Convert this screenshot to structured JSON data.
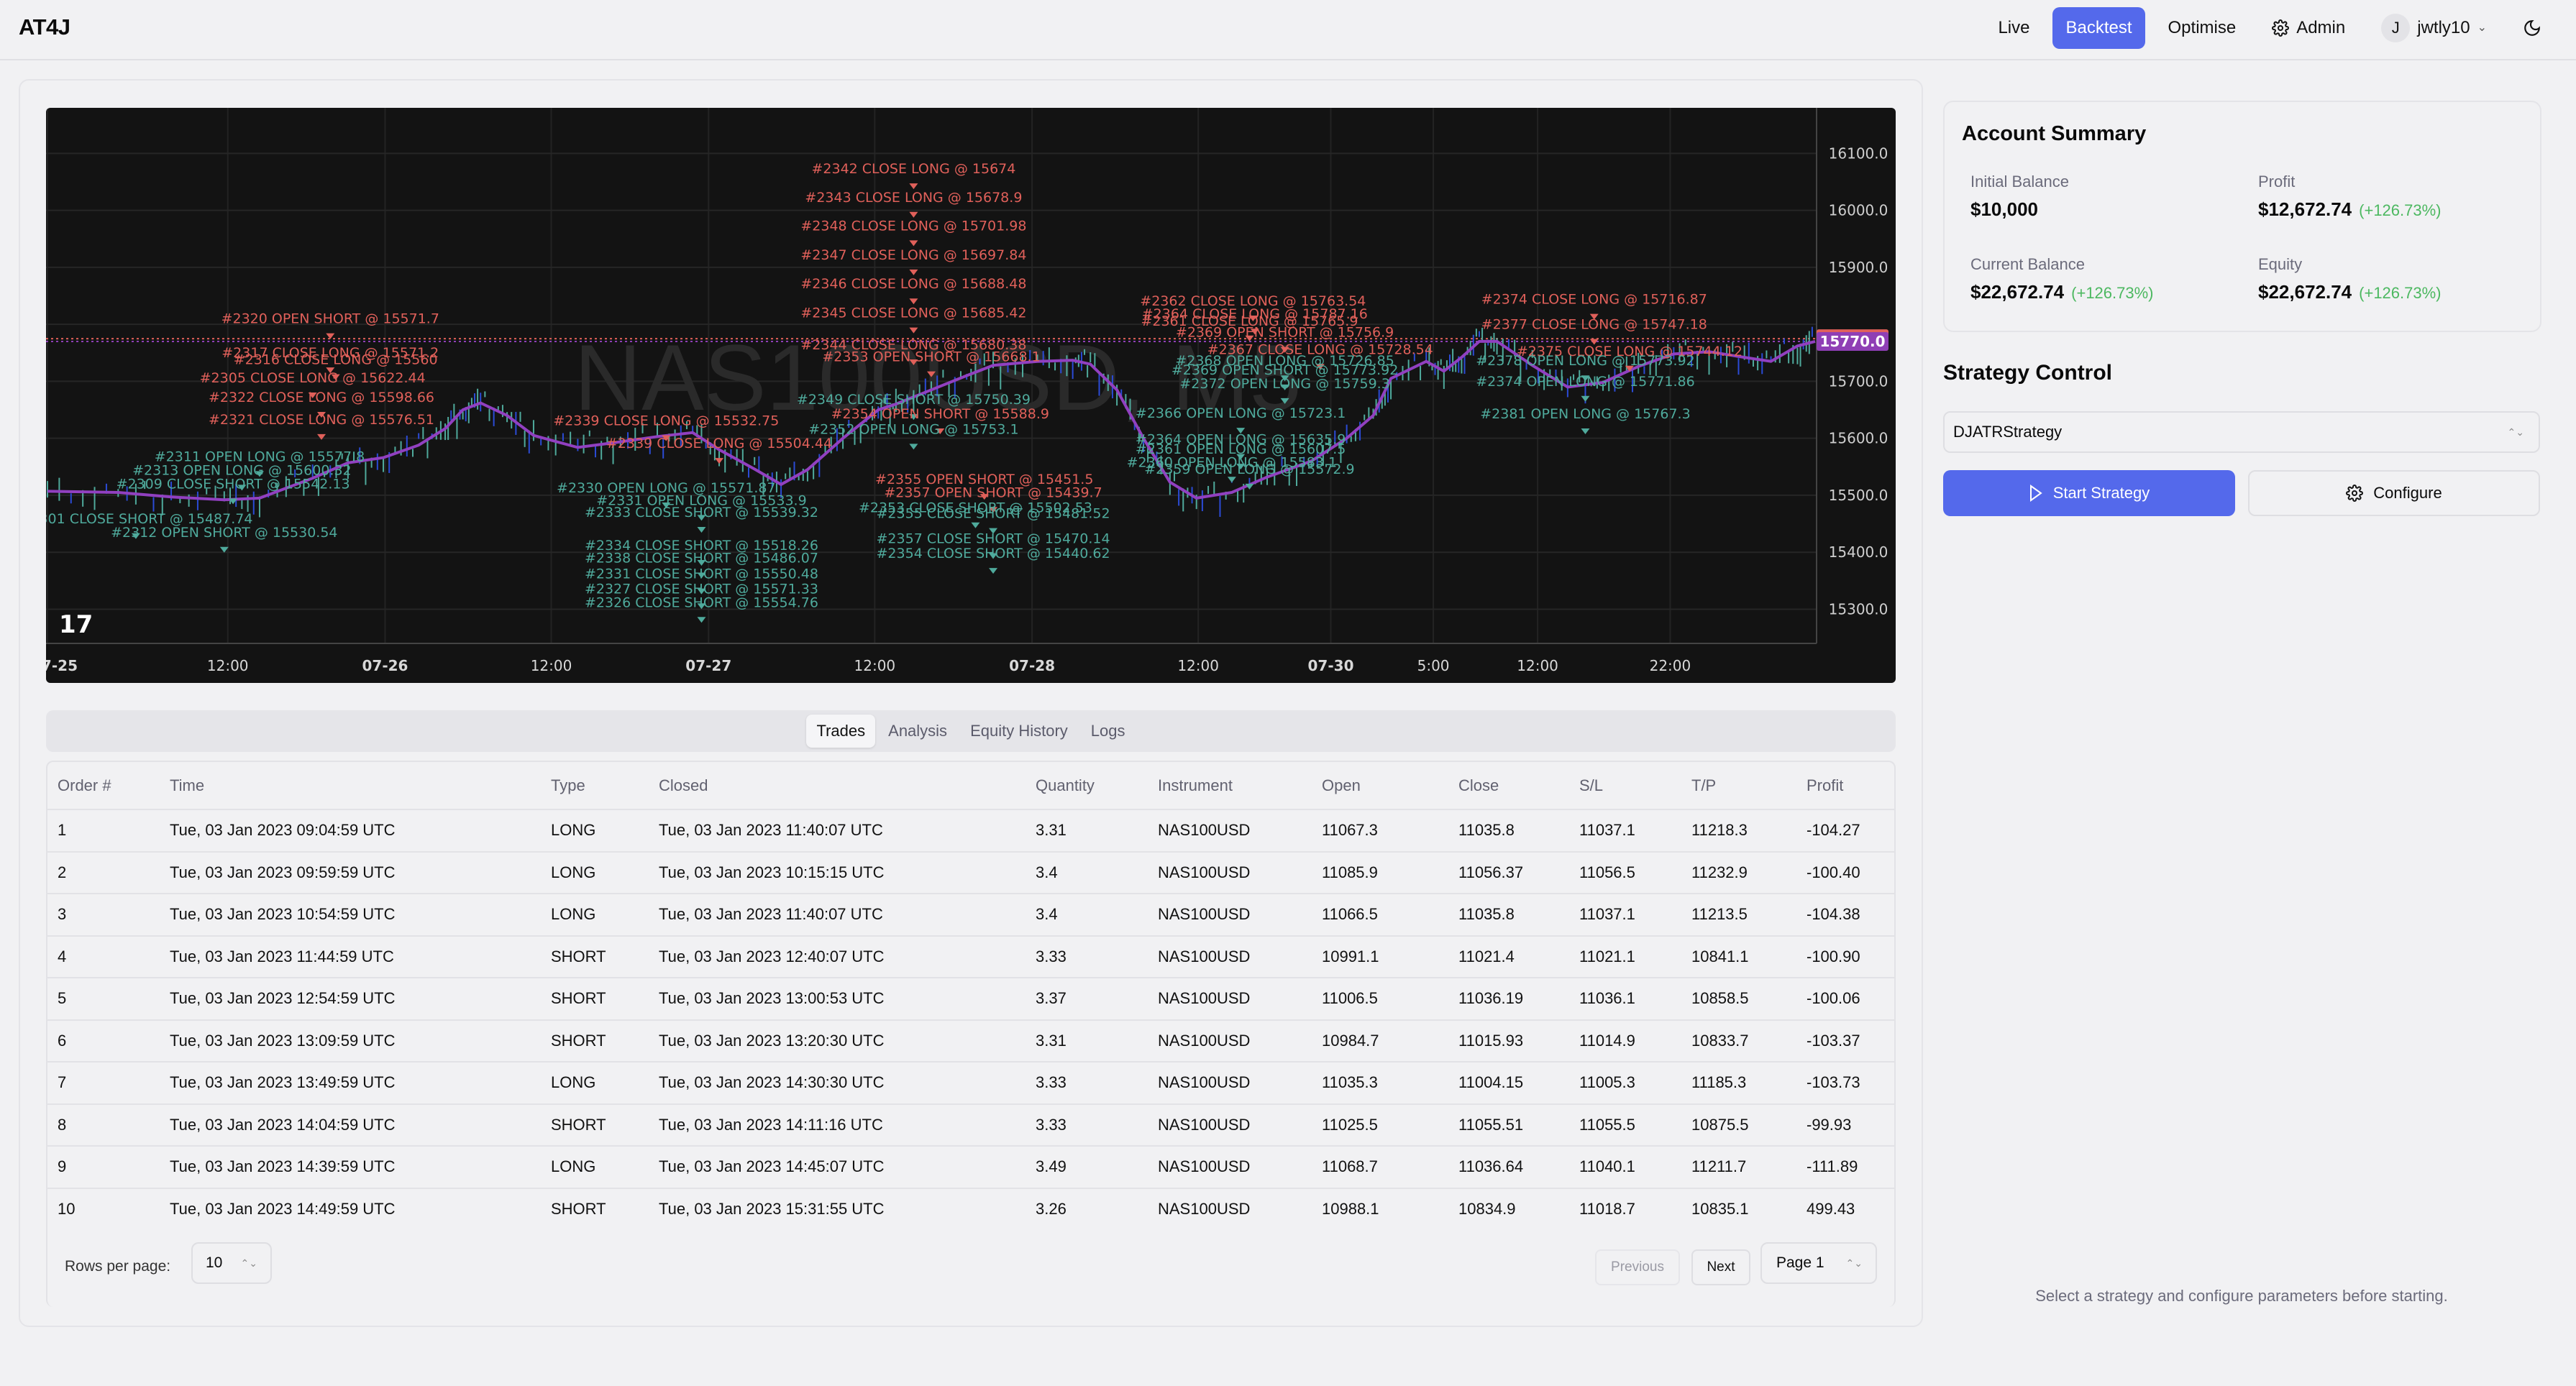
{
  "app": {
    "title": "AT4J"
  },
  "nav": {
    "items": [
      {
        "label": "Live",
        "active": false
      },
      {
        "label": "Backtest",
        "active": true
      },
      {
        "label": "Optimise",
        "active": false
      },
      {
        "label": "Admin",
        "icon": "gear-icon",
        "active": false
      }
    ],
    "user": {
      "initial": "J",
      "name": "jwtly10"
    },
    "theme_icon": "moon-icon"
  },
  "chart": {
    "watermark": "NAS100USD, M5",
    "logo": "TV",
    "price_axis": [
      "16100.0",
      "16000.0",
      "15900.0",
      "15800.0",
      "15700.0",
      "15600.0",
      "15500.0",
      "15400.0",
      "15300.0"
    ],
    "price_range": [
      15240,
      16180
    ],
    "time_axis": [
      {
        "label": "07-25",
        "bold": true,
        "pos": 0.0
      },
      {
        "label": "12:00",
        "bold": false,
        "pos": 0.102
      },
      {
        "label": "07-26",
        "bold": true,
        "pos": 0.191
      },
      {
        "label": "12:00",
        "bold": false,
        "pos": 0.285
      },
      {
        "label": "07-27",
        "bold": true,
        "pos": 0.374
      },
      {
        "label": "12:00",
        "bold": false,
        "pos": 0.468
      },
      {
        "label": "07-28",
        "bold": true,
        "pos": 0.557
      },
      {
        "label": "12:00",
        "bold": false,
        "pos": 0.651
      },
      {
        "label": "07-30",
        "bold": true,
        "pos": 0.726
      },
      {
        "label": "5:00",
        "bold": false,
        "pos": 0.784
      },
      {
        "label": "12:00",
        "bold": false,
        "pos": 0.843
      },
      {
        "label": "22:00",
        "bold": false,
        "pos": 0.918
      }
    ],
    "last_price": {
      "value": "15774.8",
      "color": "#e0605a"
    },
    "ma_price": {
      "value": "15770.0",
      "color": "#8f3fb5"
    },
    "colors": {
      "long": "#e0605a",
      "short": "#4faa9c",
      "ma": "#9140c0"
    },
    "ma_line": [
      [
        0.0,
        15507
      ],
      [
        0.04,
        15505
      ],
      [
        0.07,
        15497
      ],
      [
        0.1,
        15492
      ],
      [
        0.12,
        15495
      ],
      [
        0.15,
        15530
      ],
      [
        0.17,
        15557
      ],
      [
        0.19,
        15566
      ],
      [
        0.21,
        15588
      ],
      [
        0.225,
        15617
      ],
      [
        0.235,
        15650
      ],
      [
        0.245,
        15662
      ],
      [
        0.26,
        15640
      ],
      [
        0.275,
        15605
      ],
      [
        0.3,
        15584
      ],
      [
        0.32,
        15592
      ],
      [
        0.345,
        15603
      ],
      [
        0.365,
        15610
      ],
      [
        0.38,
        15580
      ],
      [
        0.4,
        15546
      ],
      [
        0.415,
        15519
      ],
      [
        0.43,
        15545
      ],
      [
        0.45,
        15600
      ],
      [
        0.47,
        15650
      ],
      [
        0.48,
        15660
      ],
      [
        0.5,
        15685
      ],
      [
        0.52,
        15710
      ],
      [
        0.535,
        15728
      ],
      [
        0.56,
        15735
      ],
      [
        0.58,
        15737
      ],
      [
        0.59,
        15730
      ],
      [
        0.605,
        15685
      ],
      [
        0.62,
        15600
      ],
      [
        0.635,
        15523
      ],
      [
        0.65,
        15495
      ],
      [
        0.67,
        15505
      ],
      [
        0.69,
        15532
      ],
      [
        0.715,
        15560
      ],
      [
        0.735,
        15600
      ],
      [
        0.75,
        15640
      ],
      [
        0.76,
        15705
      ],
      [
        0.78,
        15735
      ],
      [
        0.79,
        15718
      ],
      [
        0.8,
        15742
      ],
      [
        0.81,
        15770
      ],
      [
        0.82,
        15770
      ],
      [
        0.84,
        15728
      ],
      [
        0.86,
        15690
      ],
      [
        0.88,
        15698
      ],
      [
        0.9,
        15726
      ],
      [
        0.92,
        15748
      ],
      [
        0.94,
        15752
      ],
      [
        0.96,
        15742
      ],
      [
        0.975,
        15735
      ],
      [
        0.99,
        15762
      ],
      [
        1.0,
        15770
      ]
    ],
    "annotations": [
      {
        "text": "#2342 CLOSE LONG @ 15674",
        "side": "long",
        "x": 0.49,
        "price": 16065
      },
      {
        "text": "#2343 CLOSE LONG @ 15678.9",
        "side": "long",
        "x": 0.49,
        "price": 16015
      },
      {
        "text": "#2348 CLOSE LONG @ 15701.98",
        "side": "long",
        "x": 0.49,
        "price": 15965
      },
      {
        "text": "#2347 CLOSE LONG @ 15697.84",
        "side": "long",
        "x": 0.49,
        "price": 15914
      },
      {
        "text": "#2346 CLOSE LONG @ 15688.48",
        "side": "long",
        "x": 0.49,
        "price": 15863
      },
      {
        "text": "#2345 CLOSE LONG @ 15685.42",
        "side": "long",
        "x": 0.49,
        "price": 15812
      },
      {
        "text": "#2344 CLOSE LONG @ 15680.38",
        "side": "long",
        "x": 0.49,
        "price": 15756
      },
      {
        "text": "#2353 OPEN SHORT @ 15668.1",
        "side": "long",
        "x": 0.5,
        "price": 15735
      },
      {
        "text": "#2349 CLOSE SHORT @ 15750.39",
        "side": "short",
        "x": 0.49,
        "price": 15660
      },
      {
        "text": "#2354 OPEN SHORT @ 15588.9",
        "side": "long",
        "x": 0.505,
        "price": 15635
      },
      {
        "text": "#2352 OPEN LONG @ 15753.1",
        "side": "short",
        "x": 0.49,
        "price": 15608
      },
      {
        "text": "#2320 OPEN SHORT @ 15571.7",
        "side": "long",
        "x": 0.16,
        "price": 15802
      },
      {
        "text": "#2317 CLOSE LONG @ 15571.2",
        "side": "long",
        "x": 0.16,
        "price": 15742
      },
      {
        "text": "#2316 CLOSE LONG @ 15560",
        "side": "long",
        "x": 0.163,
        "price": 15730
      },
      {
        "text": "#2305 CLOSE LONG @ 15622.44",
        "side": "long",
        "x": 0.15,
        "price": 15698
      },
      {
        "text": "#2322 CLOSE LONG @ 15598.66",
        "side": "long",
        "x": 0.155,
        "price": 15664
      },
      {
        "text": "#2321 CLOSE LONG @ 15576.51",
        "side": "long",
        "x": 0.155,
        "price": 15625
      },
      {
        "text": "#2339 CLOSE LONG @ 15532.75",
        "side": "long",
        "x": 0.35,
        "price": 15623
      },
      {
        "text": "#2339 CLOSE LONG @ 15504.44",
        "side": "long",
        "x": 0.38,
        "price": 15583
      },
      {
        "text": "#2311 OPEN LONG @ 15577.8",
        "side": "short",
        "x": 0.12,
        "price": 15560
      },
      {
        "text": "#2313 OPEN LONG @ 15600.32",
        "side": "short",
        "x": 0.11,
        "price": 15536
      },
      {
        "text": "#2309 CLOSE SHORT @ 15542.13",
        "side": "short",
        "x": 0.105,
        "price": 15512
      },
      {
        "text": "#2301 CLOSE SHORT @ 15487.74",
        "side": "short",
        "x": 0.05,
        "price": 15451
      },
      {
        "text": "#2312 OPEN SHORT @ 15530.54",
        "side": "short",
        "x": 0.1,
        "price": 15427
      },
      {
        "text": "#2330 OPEN LONG @ 15571.87",
        "side": "short",
        "x": 0.35,
        "price": 15505
      },
      {
        "text": "#2331 OPEN LONG @ 15533.9",
        "side": "short",
        "x": 0.37,
        "price": 15483
      },
      {
        "text": "#2333 CLOSE SHORT @ 15539.32",
        "side": "short",
        "x": 0.37,
        "price": 15462
      },
      {
        "text": "#2334 CLOSE SHORT @ 15518.26",
        "side": "short",
        "x": 0.37,
        "price": 15404
      },
      {
        "text": "#2338 CLOSE SHORT @ 15486.07",
        "side": "short",
        "x": 0.37,
        "price": 15382
      },
      {
        "text": "#2331 CLOSE SHORT @ 15550.48",
        "side": "short",
        "x": 0.37,
        "price": 15354
      },
      {
        "text": "#2327 CLOSE SHORT @ 15571.33",
        "side": "short",
        "x": 0.37,
        "price": 15328
      },
      {
        "text": "#2326 CLOSE SHORT @ 15554.76",
        "side": "short",
        "x": 0.37,
        "price": 15304
      },
      {
        "text": "#2355 OPEN SHORT @ 15451.5",
        "side": "long",
        "x": 0.53,
        "price": 15520
      },
      {
        "text": "#2357 OPEN SHORT @ 15439.7",
        "side": "long",
        "x": 0.535,
        "price": 15497
      },
      {
        "text": "#2353 CLOSE SHORT @ 15502.53",
        "side": "short",
        "x": 0.525,
        "price": 15470
      },
      {
        "text": "#2355 CLOSE SHORT @ 15481.52",
        "side": "short",
        "x": 0.535,
        "price": 15460
      },
      {
        "text": "#2357 CLOSE SHORT @ 15470.14",
        "side": "short",
        "x": 0.535,
        "price": 15416
      },
      {
        "text": "#2354 CLOSE SHORT @ 15440.62",
        "side": "short",
        "x": 0.535,
        "price": 15390
      },
      {
        "text": "#2364 OPEN LONG @ 15635.9",
        "side": "short",
        "x": 0.675,
        "price": 15590
      },
      {
        "text": "#2361 OPEN LONG @ 15607.5",
        "side": "short",
        "x": 0.675,
        "price": 15573
      },
      {
        "text": "#2360 OPEN LONG @ 15583.1",
        "side": "short",
        "x": 0.67,
        "price": 15550
      },
      {
        "text": "#2359 OPEN LONG @ 15572.9",
        "side": "short",
        "x": 0.68,
        "price": 15538
      },
      {
        "text": "#2362 CLOSE LONG @ 15763.54",
        "side": "long",
        "x": 0.682,
        "price": 15833
      },
      {
        "text": "#2364 CLOSE LONG @ 15787.16",
        "side": "long",
        "x": 0.683,
        "price": 15810
      },
      {
        "text": "#2361 CLOSE LONG @ 15765.9",
        "side": "long",
        "x": 0.68,
        "price": 15798
      },
      {
        "text": "#2369 OPEN SHORT @ 15756.9",
        "side": "long",
        "x": 0.7,
        "price": 15778
      },
      {
        "text": "#2367 CLOSE LONG @ 15728.54",
        "side": "long",
        "x": 0.72,
        "price": 15748
      },
      {
        "text": "#2368 OPEN LONG @ 15726.85",
        "side": "short",
        "x": 0.7,
        "price": 15728
      },
      {
        "text": "#2369 OPEN SHORT @ 15773.92",
        "side": "short",
        "x": 0.7,
        "price": 15712
      },
      {
        "text": "#2372 OPEN LONG @ 15759.3",
        "side": "short",
        "x": 0.7,
        "price": 15688
      },
      {
        "text": "#2366 OPEN LONG @ 15723.1",
        "side": "short",
        "x": 0.675,
        "price": 15636
      },
      {
        "text": "#2374 CLOSE LONG @ 15716.87",
        "side": "long",
        "x": 0.875,
        "price": 15836
      },
      {
        "text": "#2377 CLOSE LONG @ 15747.18",
        "side": "long",
        "x": 0.875,
        "price": 15792
      },
      {
        "text": "#2375 CLOSE LONG @ 15744.12",
        "side": "long",
        "x": 0.895,
        "price": 15745
      },
      {
        "text": "#2378 OPEN LONG @ 15773.92",
        "side": "short",
        "x": 0.87,
        "price": 15728
      },
      {
        "text": "#2374 OPEN LONG @ 15771.86",
        "side": "short",
        "x": 0.87,
        "price": 15692
      },
      {
        "text": "#2381 OPEN LONG @ 15767.3",
        "side": "short",
        "x": 0.87,
        "price": 15635
      }
    ]
  },
  "tabs": [
    {
      "label": "Trades",
      "active": true
    },
    {
      "label": "Analysis",
      "active": false
    },
    {
      "label": "Equity History",
      "active": false
    },
    {
      "label": "Logs",
      "active": false
    }
  ],
  "trades": {
    "columns": [
      "Order #",
      "Time",
      "Type",
      "Closed",
      "Quantity",
      "Instrument",
      "Open",
      "Close",
      "S/L",
      "T/P",
      "Profit"
    ],
    "rows": [
      [
        "1",
        "Tue, 03 Jan 2023 09:04:59 UTC",
        "LONG",
        "Tue, 03 Jan 2023 11:40:07 UTC",
        "3.31",
        "NAS100USD",
        "11067.3",
        "11035.8",
        "11037.1",
        "11218.3",
        "-104.27"
      ],
      [
        "2",
        "Tue, 03 Jan 2023 09:59:59 UTC",
        "LONG",
        "Tue, 03 Jan 2023 10:15:15 UTC",
        "3.4",
        "NAS100USD",
        "11085.9",
        "11056.37",
        "11056.5",
        "11232.9",
        "-100.40"
      ],
      [
        "3",
        "Tue, 03 Jan 2023 10:54:59 UTC",
        "LONG",
        "Tue, 03 Jan 2023 11:40:07 UTC",
        "3.4",
        "NAS100USD",
        "11066.5",
        "11035.8",
        "11037.1",
        "11213.5",
        "-104.38"
      ],
      [
        "4",
        "Tue, 03 Jan 2023 11:44:59 UTC",
        "SHORT",
        "Tue, 03 Jan 2023 12:40:07 UTC",
        "3.33",
        "NAS100USD",
        "10991.1",
        "11021.4",
        "11021.1",
        "10841.1",
        "-100.90"
      ],
      [
        "5",
        "Tue, 03 Jan 2023 12:54:59 UTC",
        "SHORT",
        "Tue, 03 Jan 2023 13:00:53 UTC",
        "3.37",
        "NAS100USD",
        "11006.5",
        "11036.19",
        "11036.1",
        "10858.5",
        "-100.06"
      ],
      [
        "6",
        "Tue, 03 Jan 2023 13:09:59 UTC",
        "SHORT",
        "Tue, 03 Jan 2023 13:20:30 UTC",
        "3.31",
        "NAS100USD",
        "10984.7",
        "11015.93",
        "11014.9",
        "10833.7",
        "-103.37"
      ],
      [
        "7",
        "Tue, 03 Jan 2023 13:49:59 UTC",
        "LONG",
        "Tue, 03 Jan 2023 14:30:30 UTC",
        "3.33",
        "NAS100USD",
        "11035.3",
        "11004.15",
        "11005.3",
        "11185.3",
        "-103.73"
      ],
      [
        "8",
        "Tue, 03 Jan 2023 14:04:59 UTC",
        "SHORT",
        "Tue, 03 Jan 2023 14:11:16 UTC",
        "3.33",
        "NAS100USD",
        "11025.5",
        "11055.51",
        "11055.5",
        "10875.5",
        "-99.93"
      ],
      [
        "9",
        "Tue, 03 Jan 2023 14:39:59 UTC",
        "LONG",
        "Tue, 03 Jan 2023 14:45:07 UTC",
        "3.49",
        "NAS100USD",
        "11068.7",
        "11036.64",
        "11040.1",
        "11211.7",
        "-111.89"
      ],
      [
        "10",
        "Tue, 03 Jan 2023 14:49:59 UTC",
        "SHORT",
        "Tue, 03 Jan 2023 15:31:55 UTC",
        "3.26",
        "NAS100USD",
        "10988.1",
        "10834.9",
        "11018.7",
        "10835.1",
        "499.43"
      ]
    ]
  },
  "pagination": {
    "rows_per_page_label": "Rows per page:",
    "rows_per_page": "10",
    "previous_label": "Previous",
    "next_label": "Next",
    "page_label": "Page 1"
  },
  "account_summary": {
    "title": "Account Summary",
    "initial_balance": {
      "label": "Initial Balance",
      "value": "$10,000"
    },
    "profit": {
      "label": "Profit",
      "value": "$12,672.74",
      "pct": "(+126.73%)"
    },
    "current_balance": {
      "label": "Current Balance",
      "value": "$22,672.74",
      "pct": "(+126.73%)"
    },
    "equity": {
      "label": "Equity",
      "value": "$22,672.74",
      "pct": "(+126.73%)"
    },
    "positive_color": "#4cb860"
  },
  "strategy_control": {
    "title": "Strategy Control",
    "selected_strategy": "DJATRStrategy",
    "start_label": "Start Strategy",
    "configure_label": "Configure",
    "hint": "Select a strategy and configure parameters before starting."
  }
}
